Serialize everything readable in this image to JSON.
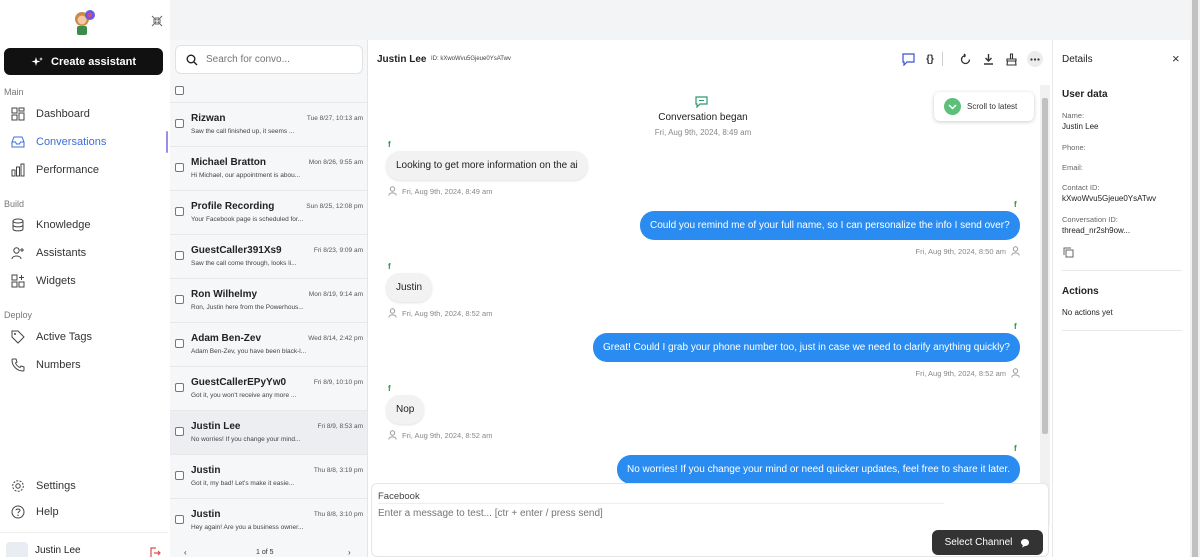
{
  "sidebar": {
    "create_label": "Create assistant",
    "sections": {
      "main": "Main",
      "build": "Build",
      "deploy": "Deploy"
    },
    "items": [
      {
        "label": "Dashboard",
        "icon": "dashboard-icon"
      },
      {
        "label": "Conversations",
        "icon": "inbox-icon",
        "active": true
      },
      {
        "label": "Performance",
        "icon": "bar-chart-icon"
      },
      {
        "label": "Knowledge",
        "icon": "database-icon"
      },
      {
        "label": "Assistants",
        "icon": "user-plus-icon"
      },
      {
        "label": "Widgets",
        "icon": "widgets-icon"
      },
      {
        "label": "Active Tags",
        "icon": "tag-icon"
      },
      {
        "label": "Numbers",
        "icon": "phone-icon"
      }
    ],
    "settings_label": "Settings",
    "help_label": "Help",
    "user_name": "Justin Lee"
  },
  "list": {
    "search_placeholder": "Search for convo...",
    "items": [
      {
        "name": "Rizwan",
        "date": "Tue 8/27, 10:13 am",
        "preview": "Saw the call finished up, it seems ..."
      },
      {
        "name": "Michael Bratton",
        "date": "Mon 8/26, 9:55 am",
        "preview": "Hi Michael, our appointment is abou..."
      },
      {
        "name": "Profile Recording",
        "date": "Sun 8/25, 12:08 pm",
        "preview": "Your Facebook page is scheduled for..."
      },
      {
        "name": "GuestCaller391Xs9",
        "date": "Fri 8/23, 9:09 am",
        "preview": "Saw the call come through, looks li..."
      },
      {
        "name": "Ron Wilhelmy",
        "date": "Mon 8/19, 9:14 am",
        "preview": "Ron, Justin here from the Powerhous..."
      },
      {
        "name": "Adam Ben-Zev",
        "date": "Wed 8/14, 2:42 pm",
        "preview": "Adam Ben-Zev, you have been black-l..."
      },
      {
        "name": "GuestCallerEPyYw0",
        "date": "Fri 8/9, 10:10 pm",
        "preview": "Got it, you won't receive any more ..."
      },
      {
        "name": "Justin Lee",
        "date": "Fri 8/9, 8:53 am",
        "preview": "No worries! If you change your mind...",
        "selected": true
      },
      {
        "name": "Justin",
        "date": "Thu 8/8, 3:19 pm",
        "preview": "Got it, my bad! Let's make it easie..."
      },
      {
        "name": "Justin",
        "date": "Thu 8/8, 3:10 pm",
        "preview": "Hey again! Are you a business owner..."
      }
    ],
    "pager": "1 of 5"
  },
  "chat": {
    "name": "Justin Lee",
    "id_text": "ID: kXwoWvu5Gjeue0YsATwv",
    "began_title": "Conversation began",
    "began_time": "Fri, Aug 9th, 2024, 8:49 am",
    "scroll_label": "Scroll to latest",
    "channel_mark": "f",
    "messages": [
      {
        "dir": "in",
        "text": "Looking to get more information on the ai",
        "time": "Fri, Aug 9th, 2024, 8:49 am"
      },
      {
        "dir": "out",
        "text": "Could you remind me of your full name, so I can personalize the info I send over?",
        "time": "Fri, Aug 9th, 2024, 8:50 am"
      },
      {
        "dir": "in",
        "text": "Justin",
        "time": "Fri, Aug 9th, 2024, 8:52 am"
      },
      {
        "dir": "out",
        "text": "Great! Could I grab your phone number too, just in case we need to clarify anything quickly?",
        "time": "Fri, Aug 9th, 2024, 8:52 am"
      },
      {
        "dir": "in",
        "text": "Nop",
        "time": "Fri, Aug 9th, 2024, 8:52 am"
      },
      {
        "dir": "out",
        "text": "No worries! If you change your mind or need quicker updates, feel free to share it later.",
        "time": ""
      }
    ],
    "composer_channel": "Facebook",
    "composer_placeholder": "Enter a message to test... [ctr + enter / press send]",
    "select_channel_label": "Select Channel"
  },
  "details": {
    "title": "Details",
    "user_data_title": "User data",
    "name_label": "Name:",
    "name_value": "Justin Lee",
    "phone_label": "Phone:",
    "email_label": "Email:",
    "contact_label": "Contact ID:",
    "contact_value": "kXwoWvu5Gjeue0YsATwv",
    "conversation_label": "Conversation ID:",
    "conversation_value": "thread_nr2sh9ow...",
    "actions_title": "Actions",
    "actions_empty": "No actions yet"
  },
  "colors": {
    "accent": "#2a8cf0",
    "active_nav": "#3b6fd8",
    "active_bar": "#9c8bea",
    "channel": "#1a9b3a"
  }
}
